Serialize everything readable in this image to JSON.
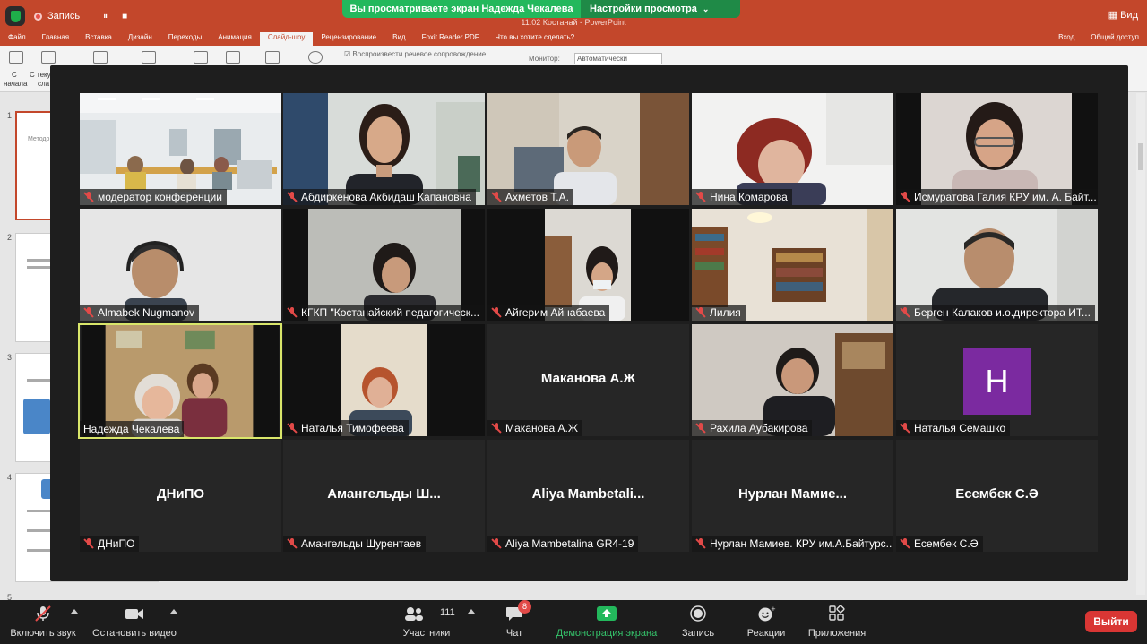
{
  "share_banner": {
    "viewing_text": "Вы просматриваете экран Надежда Чекалева",
    "view_settings": "Настройки просмотра"
  },
  "powerpoint": {
    "recording_label": "Запись",
    "doc_title": "11.02 Костанай - PowerPoint",
    "view_label": "Вид",
    "tabs": [
      "Файл",
      "Главная",
      "Вставка",
      "Дизайн",
      "Переходы",
      "Анимация",
      "Слайд-шоу",
      "Рецензирование",
      "Вид",
      "Foxit Reader PDF",
      "Что вы хотите сделать?"
    ],
    "active_tab": "Слайд-шоу",
    "login": "Вход",
    "share": "Общий доступ",
    "ribbon": {
      "from_start_line1": "С",
      "from_start_line2": "начала",
      "from_current_line1": "С теку",
      "from_current_line2": "сла",
      "narration_check": "Воспроизвести речевое сопровождение",
      "monitor_label": "Монитор:",
      "monitor_value": "Автоматически"
    },
    "slide_numbers": [
      "1",
      "2",
      "3",
      "4",
      "5"
    ],
    "slide1_text": "Методо... пед..."
  },
  "participants": [
    {
      "name": "модератор конференции",
      "muted": true,
      "video": true
    },
    {
      "name": "Абдиркенова Акбидаш Капановна",
      "muted": true,
      "video": true
    },
    {
      "name": "Ахметов Т.А.",
      "muted": true,
      "video": true
    },
    {
      "name": "Нина Комарова",
      "muted": true,
      "video": true
    },
    {
      "name": "Исмуратова Галия КРУ им. А. Байт...",
      "muted": true,
      "video": true
    },
    {
      "name": "Almabek Nugmanov",
      "muted": true,
      "video": true
    },
    {
      "name": "КГКП \"Костанайский педагогическ...",
      "muted": true,
      "video": true
    },
    {
      "name": "Айгерим Айнабаева",
      "muted": true,
      "video": true
    },
    {
      "name": "Лилия",
      "muted": true,
      "video": true
    },
    {
      "name": "Берген Калаков и.о.директора ИТ...",
      "muted": true,
      "video": true
    },
    {
      "name": "Надежда Чекалева",
      "muted": false,
      "video": true,
      "active": true
    },
    {
      "name": "Наталья Тимофеева",
      "muted": true,
      "video": true
    },
    {
      "name": "Маканова А.Ж",
      "muted": true,
      "video": false,
      "center": "Маканова А.Ж"
    },
    {
      "name": "Рахила Аубакирова",
      "muted": true,
      "video": true
    },
    {
      "name": "Наталья Семашко",
      "muted": true,
      "video": false,
      "avatar_letter": "Н"
    },
    {
      "name": "ДНиПО",
      "muted": true,
      "video": false,
      "center": "ДНиПО"
    },
    {
      "name": "Амангельды Шурентаев",
      "muted": true,
      "video": false,
      "center": "Амангельды  Ш..."
    },
    {
      "name": "Aliya Mambetalina GR4-19",
      "muted": true,
      "video": false,
      "center": "Aliya  Mambetali..."
    },
    {
      "name": "Нурлан Мамиев. КРУ им.А.Байтурс...",
      "muted": true,
      "video": false,
      "center": "Нурлан  Мамие..."
    },
    {
      "name": "Есембек С.Ә",
      "muted": true,
      "video": false,
      "center": "Есембек С.Ә"
    }
  ],
  "toolbar": {
    "unmute": "Включить звук",
    "start_video": "Остановить видео",
    "participants": "Участники",
    "participants_count": "111",
    "chat": "Чат",
    "chat_badge": "8",
    "share_screen": "Демонстрация экрана",
    "record": "Запись",
    "reactions": "Реакции",
    "apps": "Приложения",
    "leave": "Выйти"
  },
  "colors": {
    "zoom_green": "#23b85c",
    "ppt_accent": "#c3472b",
    "leave_red": "#d93634",
    "active_speaker": "#d9e66a",
    "avatar_purple": "#7b2aa0"
  }
}
